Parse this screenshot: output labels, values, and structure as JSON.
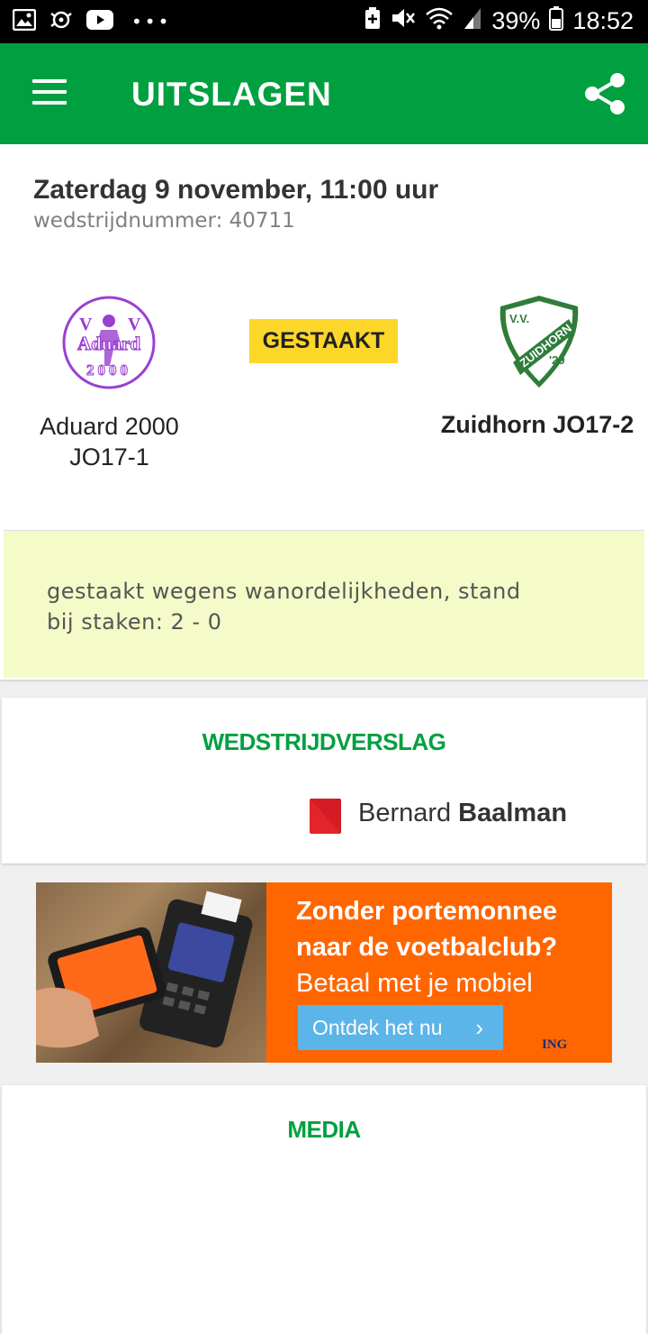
{
  "status_bar": {
    "battery": "39%",
    "time": "18:52",
    "icons": [
      "image-icon",
      "cast-icon",
      "youtube-icon",
      "more-dots-icon",
      "battery-saver-icon",
      "mute-icon",
      "wifi-icon",
      "signal-icon",
      "battery-icon"
    ]
  },
  "app_bar": {
    "title": "UITSLAGEN",
    "menu_icon": "hamburger-menu-icon",
    "share_icon": "share-icon",
    "color": "#00a040"
  },
  "match": {
    "date": "Zaterdag 9 november, 11:00 uur",
    "match_number": "wedstrijdnummer: 40711",
    "status": "GESTAAKT",
    "home": {
      "name": "Aduard 2000 JO17-1",
      "logo_text_top": "V   V",
      "logo_text_mid": "Aduard",
      "logo_text_bottom": "2000"
    },
    "away": {
      "name": "Zuidhorn JO17-2",
      "logo_text_top": "V.V.",
      "logo_text_mid": "ZUIDHORN",
      "logo_text_bottom": "'29"
    },
    "note": "gestaakt wegens wanordelijkheden, stand bij staken: 2 - 0"
  },
  "report": {
    "title": "WEDSTRIJDVERSLAG",
    "card_type": "red-card",
    "player_first": "Bernard",
    "player_last": "Baalman"
  },
  "ad": {
    "line1": "Zonder portemonnee",
    "line2": "naar de voetbalclub?",
    "line3": "Betaal met je mobiel",
    "button": "Ontdek het nu",
    "brand": "ING"
  },
  "media": {
    "title": "MEDIA"
  }
}
